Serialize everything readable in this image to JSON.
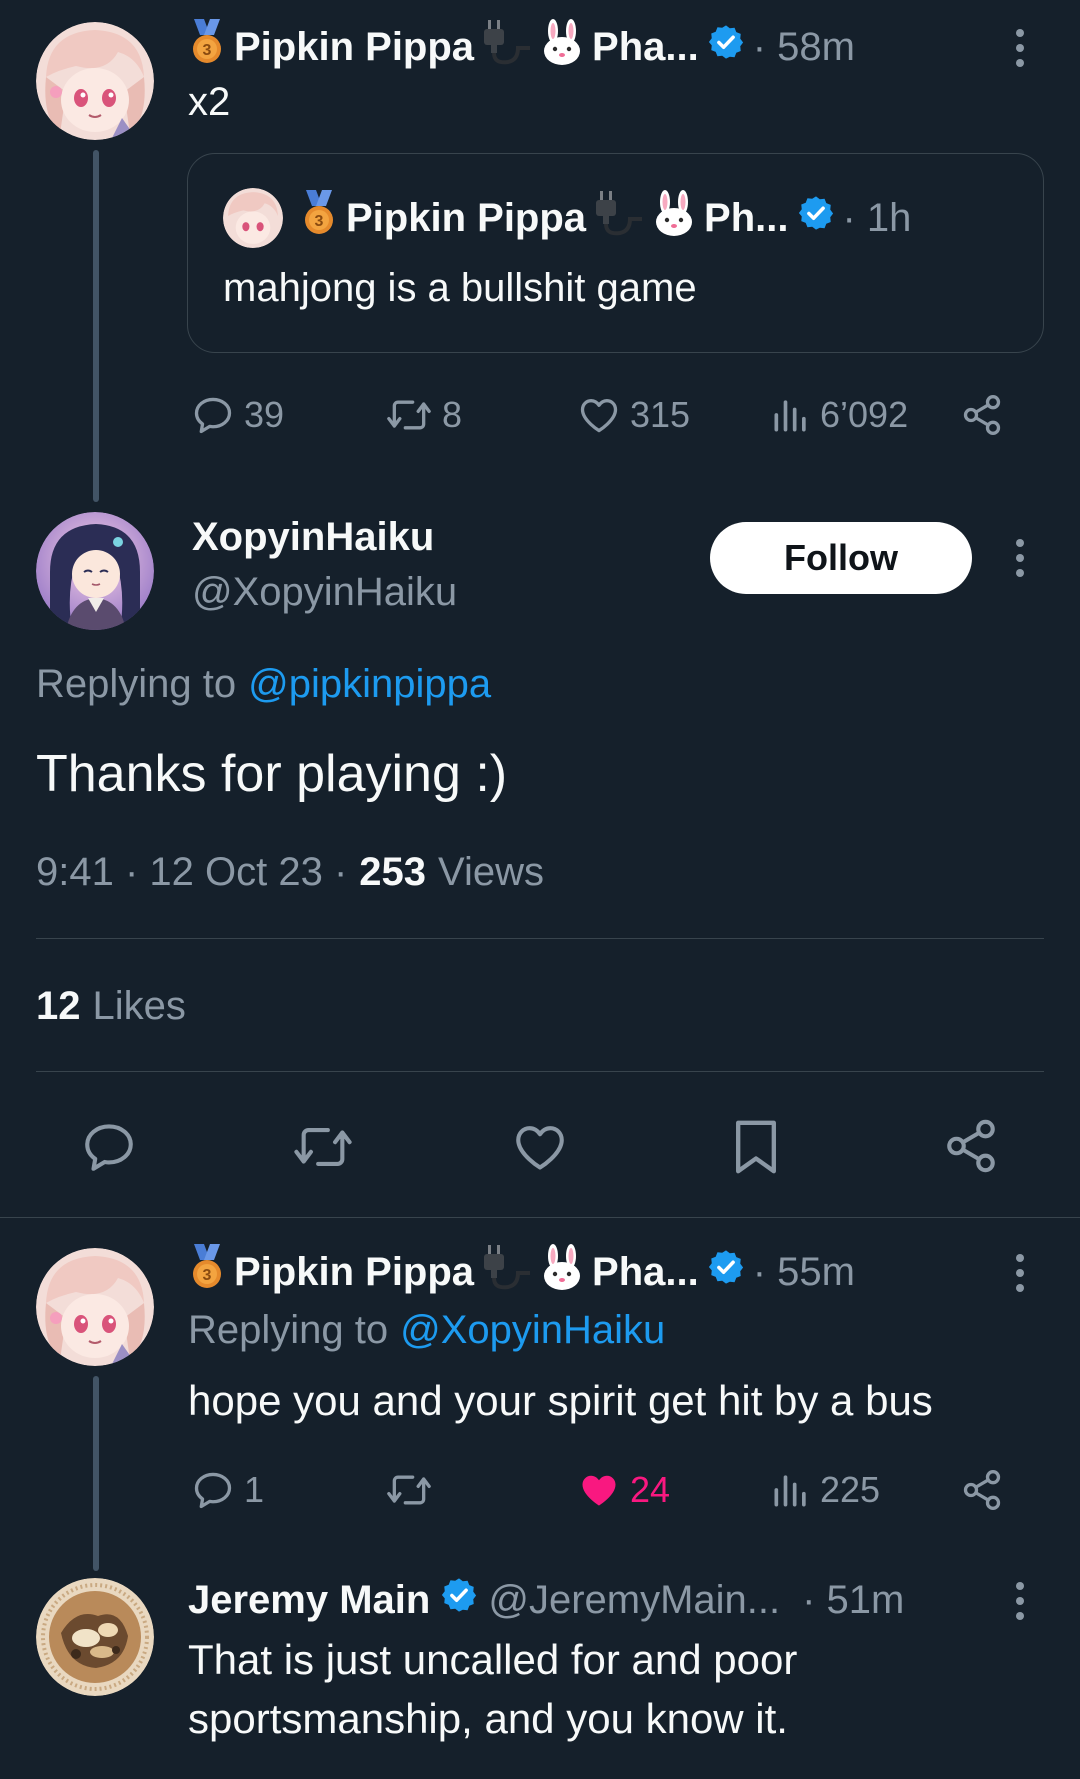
{
  "colors": {
    "background": "#15202b",
    "text": "#f7f9f9",
    "muted": "#8b98a5",
    "link": "#1d9bf0",
    "like_active": "#f91880",
    "divider": "#38444d",
    "verified": "#1d9bf0"
  },
  "top_tweet": {
    "display_name": "Pipkin Pippa",
    "name_suffix": "Pha...",
    "time": "· 58m",
    "text": "x2",
    "avatar_icon": "pink-haired-avatar",
    "quoted": {
      "display_name": "Pipkin Pippa",
      "name_suffix": "Ph...",
      "time": "· 1h",
      "text": "mahjong is a bullshit game"
    },
    "actions": {
      "replies": "39",
      "retweets": "8",
      "likes": "315",
      "views": "6’092"
    }
  },
  "main_tweet": {
    "display_name": "XopyinHaiku",
    "handle": "@XopyinHaiku",
    "follow_label": "Follow",
    "replying_to_prefix": "Replying to",
    "replying_to_handle": "@pipkinpippa",
    "text": "Thanks for playing :)",
    "meta_time": "9:41 · 12 Oct 23 ·",
    "views_count": "253",
    "views_label": "Views",
    "likes_count": "12",
    "likes_label": "Likes",
    "avatar_icon": "dark-haired-avatar"
  },
  "reply_1": {
    "display_name": "Pipkin Pippa",
    "name_suffix": "Pha...",
    "time": "· 55m",
    "replying_to_prefix": "Replying to",
    "replying_to_handle": "@XopyinHaiku",
    "text": "hope you and your spirit get hit by a bus",
    "actions": {
      "replies": "1",
      "retweets": "",
      "likes": "24",
      "views": "225"
    }
  },
  "reply_2": {
    "display_name": "Jeremy Main",
    "handle": "@JeremyMain...",
    "time": "· 51m",
    "text_line1": "That is just uncalled for and poor",
    "text_line2": "sportsmanship, and you know it.",
    "avatar_icon": "pie-avatar"
  }
}
